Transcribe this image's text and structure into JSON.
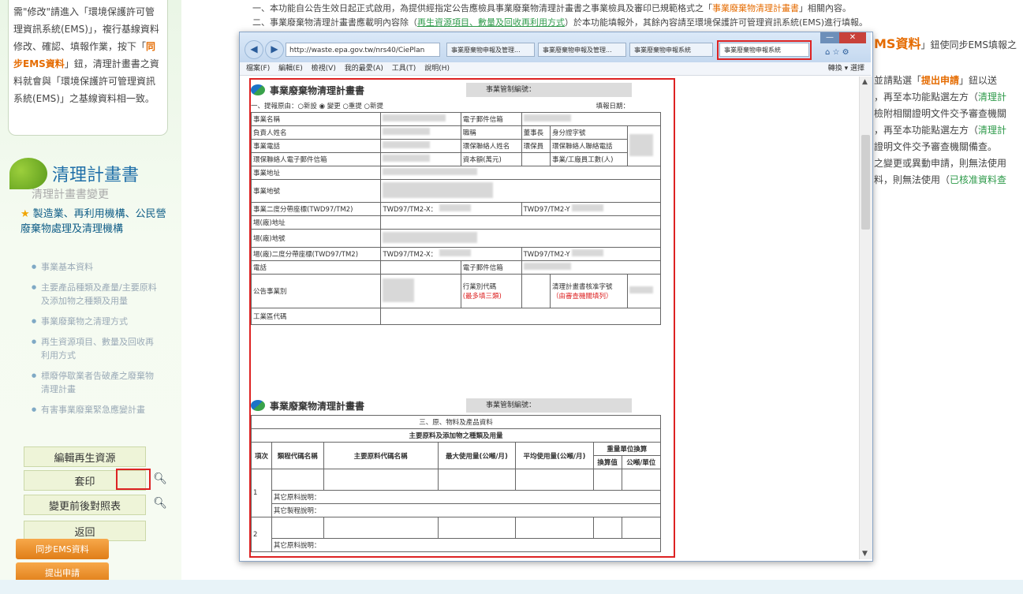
{
  "top_text": {
    "line1_pre": "一、本功能自公告生效日起正式啟用，為提供經指定公告應檢具事業廢棄物清理計畫書之事業檢具及審印已規範格式之「",
    "line1_hl": "事業廢棄物清理計畫書",
    "line1_post": "」相關內容。",
    "line2_pre": "二、事業廢棄物清理計畫書應載明內容除（",
    "line2_link": "再生資源項目、數量及回收再利用方式",
    "line2_post": "）於本功能填報外，其餘內容請至環境保護許可管理資訊系統(EMS)進行填報。"
  },
  "sidebar": {
    "notice_text_1": "需\"修改\"請進入「環境保護許可管理資訊系統(EMS)」，複行基線資料修改、確認、填報作業，按下「",
    "notice_hl": "同步EMS資料",
    "notice_text_2": "」鈕，清理計畫書之資料就會與「環境保護許可管理資訊系統(EMS)」之基線資料相一致。",
    "brand_title": "清理計畫書",
    "sub_nav": "清理計畫書變更",
    "category": "製造業、再利用機構、公民營廢棄物處理及清理機構",
    "items": [
      "事業基本資料",
      "主要產品種類及產量/主要原料及添加物之種類及用量",
      "事業廢棄物之清理方式",
      "再生資源項目、數量及回收再利用方式",
      "標廢停歇業者告破產之廢棄物清理計畫",
      "有害事業廢棄緊急應變計畫"
    ],
    "btn_edit": "編輯再生資源",
    "btn_print": "套印",
    "btn_compare": "變更前後對照表",
    "btn_back": "返回",
    "btn_sync": "同步EMS資料",
    "btn_submit": "提出申請"
  },
  "right_text": {
    "ems_label": "MS資料",
    "ems_tail": "」鈕使同步EMS填報之",
    "lines": [
      [
        "並請點選「",
        "提出申請",
        "」鈕以送"
      ],
      [
        "，再至本功能點選左方（",
        "清理計",
        ""
      ],
      [
        "檢附相關證明文件交予審查機關",
        "",
        ""
      ],
      [
        "，再至本功能點選左方（",
        "清理計",
        ""
      ],
      [
        "證明文件交予審查機關備查。",
        "",
        ""
      ],
      [
        "之變更或異動申請，則無法使用",
        "",
        ""
      ],
      [
        "料，則無法使用（",
        "已核准資料查",
        ""
      ]
    ]
  },
  "browser": {
    "address": "http://waste.epa.gov.tw/nrs40/CiePlan",
    "tabs": [
      "事業廢棄物申報及管理...",
      "事業廢棄物申報及管理...",
      "事業廢棄物申報系統",
      "事業廢棄物申報系統"
    ],
    "menus": [
      "檔案(F)",
      "編輯(E)",
      "檢視(V)",
      "我的最愛(A)",
      "工具(T)",
      "說明(H)"
    ],
    "menu_right": "轉換 ▾ 選擇"
  },
  "form1": {
    "title": "事業廢棄物清理計畫書",
    "control_no_label": "事業管制編號：",
    "reason_label": "一、提報原由：○新設 ◉ 變更 ○重提 ○新提",
    "date_label": "填報日期：",
    "rows": [
      [
        "事業名稱",
        "",
        "電子郵件信箱",
        ""
      ],
      [
        "負責人姓名",
        "",
        "職稱",
        "董事長",
        "身分證字號"
      ],
      [
        "事業電話",
        "",
        "環保聯絡人姓名",
        "環保員",
        "環保聯絡人聯絡電話"
      ],
      [
        "環保聯絡人電子郵件信箱",
        "",
        "資本額(萬元)",
        "",
        "事業/工廠員工數(人)"
      ],
      [
        "事業地址",
        ""
      ],
      [
        "事業地號",
        ""
      ],
      [
        "事業二度分帶座標(TWD97/TM2)",
        "TWD97/TM2-X：",
        "TWD97/TM2-Y"
      ],
      [
        "場(廠)地址",
        ""
      ],
      [
        "場(廠)地號",
        ""
      ],
      [
        "場(廠)二度分帶座標(TWD97/TM2)",
        "TWD97/TM2-X：",
        "TWD97/TM2-Y"
      ],
      [
        "電話",
        "",
        "電子郵件信箱",
        ""
      ],
      [
        "公告事業別",
        "",
        "行業別代碼",
        "清理計畫書核准字號"
      ],
      [
        "工業區代碼",
        ""
      ]
    ],
    "industry_note": "(最多填三類)",
    "approval_note": "（由審查機關填列）"
  },
  "form2": {
    "title": "事業廢棄物清理計畫書",
    "control_no_label": "事業管制編號：",
    "section": "三、原、物料及產品資料",
    "subsection": "主要原料及添加物之種類及用量",
    "headers": [
      "項次",
      "類程代碼名稱",
      "主要原料代碼名稱",
      "最大使用量(公噸/月)",
      "平均使用量(公噸/月)",
      "重量單位換算"
    ],
    "unit_sub": [
      "換算值",
      "公噸/單位"
    ],
    "row_labels": [
      "其它原料說明：",
      "其它製程說明：",
      "其它原料說明："
    ],
    "row_nums": [
      "1",
      "2"
    ]
  },
  "colors": {
    "accent_orange": "#e56b00",
    "link_green": "#2e9a4a",
    "highlight_red": "#d22222"
  }
}
